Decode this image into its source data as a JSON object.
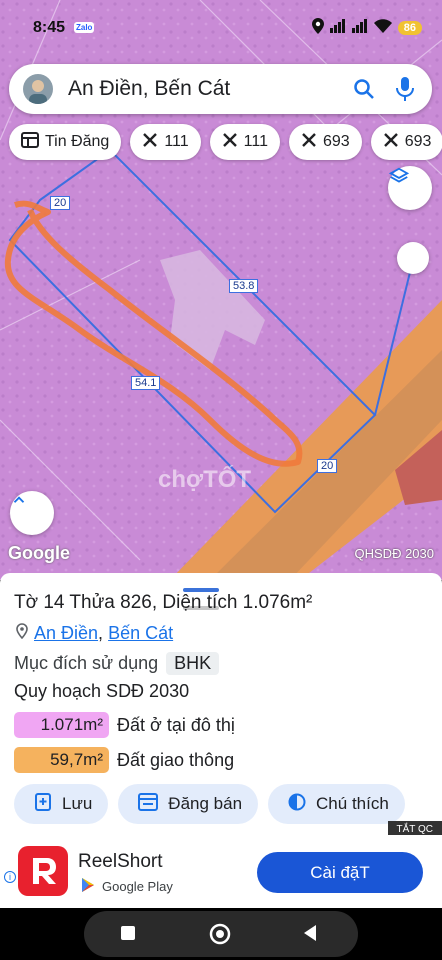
{
  "status": {
    "time": "8:45",
    "app_badge": "Zalo",
    "battery": "86"
  },
  "search": {
    "query": "An Điền, Bến Cát"
  },
  "chips": [
    {
      "label": "Tin Đăng",
      "icon": "listing-icon"
    },
    {
      "label": "111",
      "icon": "tools-icon"
    },
    {
      "label": "111",
      "icon": "tools-icon"
    },
    {
      "label": "693",
      "icon": "tools-icon"
    },
    {
      "label": "693",
      "icon": "tools-icon"
    }
  ],
  "map": {
    "edge_labels": [
      "20",
      "53.8",
      "54.1",
      "20"
    ],
    "provider": "Google",
    "layer_label": "QHSDĐ 2030",
    "watermark": "chợTỐT"
  },
  "parcel": {
    "title": "Tờ 14 Thửa 826, Diện tích 1.076m²",
    "location_parts": [
      "An Điền",
      "Bến Cát"
    ],
    "location_separator": ",",
    "purpose_label": "Mục đích sử dụng",
    "purpose_code": "BHK",
    "plan_title": "Quy hoạch SDĐ 2030",
    "zones": [
      {
        "area": "1.071m²",
        "name": "Đất ở tại đô thị",
        "color": "#f0a6f3"
      },
      {
        "area": "59,7m²",
        "name": "Đất giao thông",
        "color": "#f5b25e"
      }
    ]
  },
  "actions": [
    {
      "label": "Lưu",
      "icon": "save-icon"
    },
    {
      "label": "Đăng bán",
      "icon": "sell-icon"
    },
    {
      "label": "Chú thích",
      "icon": "legend-icon"
    }
  ],
  "ad": {
    "close_label": "TẮT QC",
    "app_name": "ReelShort",
    "store": "Google Play",
    "install_label": "Cài đặT"
  }
}
